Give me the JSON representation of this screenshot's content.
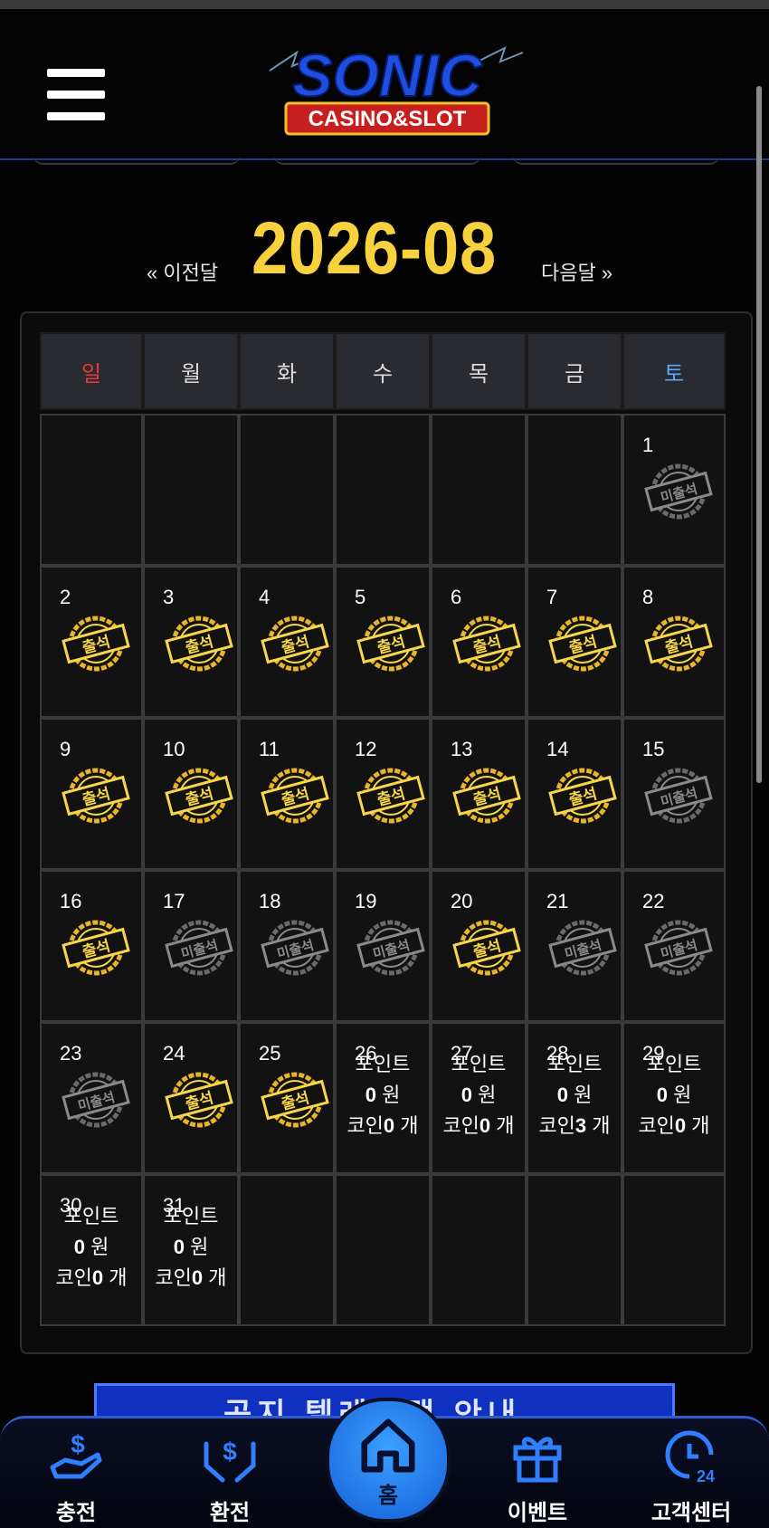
{
  "header": {
    "menu_icon": "hamburger-menu-icon",
    "logo": {
      "line1": "SONIC",
      "line2": "CASINO&SLOT"
    }
  },
  "calendar": {
    "month": "2026-08",
    "prev_label": "« 이전달",
    "next_label": "다음달 »",
    "weekdays": [
      "일",
      "월",
      "화",
      "수",
      "목",
      "금",
      "토"
    ],
    "weekday_colors": {
      "sun": "#e23a3a",
      "sat": "#5aa8ff",
      "default": "#dddddd"
    },
    "stamp_attended": "출석",
    "stamp_absent": "미출석",
    "reward_labels": {
      "points": "포인트",
      "won": "원",
      "coin": "코인",
      "count": "개"
    },
    "days": [
      {
        "day": "1",
        "status": "absent"
      },
      {
        "day": "2",
        "status": "attended"
      },
      {
        "day": "3",
        "status": "attended"
      },
      {
        "day": "4",
        "status": "attended"
      },
      {
        "day": "5",
        "status": "attended"
      },
      {
        "day": "6",
        "status": "attended"
      },
      {
        "day": "7",
        "status": "attended"
      },
      {
        "day": "8",
        "status": "attended"
      },
      {
        "day": "9",
        "status": "attended"
      },
      {
        "day": "10",
        "status": "attended"
      },
      {
        "day": "11",
        "status": "attended"
      },
      {
        "day": "12",
        "status": "attended"
      },
      {
        "day": "13",
        "status": "attended"
      },
      {
        "day": "14",
        "status": "attended"
      },
      {
        "day": "15",
        "status": "absent"
      },
      {
        "day": "16",
        "status": "attended"
      },
      {
        "day": "17",
        "status": "absent"
      },
      {
        "day": "18",
        "status": "absent"
      },
      {
        "day": "19",
        "status": "absent"
      },
      {
        "day": "20",
        "status": "attended"
      },
      {
        "day": "21",
        "status": "absent"
      },
      {
        "day": "22",
        "status": "absent"
      },
      {
        "day": "23",
        "status": "absent"
      },
      {
        "day": "24",
        "status": "attended"
      },
      {
        "day": "25",
        "status": "attended"
      },
      {
        "day": "26",
        "status": "future",
        "points": "0",
        "coins": "0"
      },
      {
        "day": "27",
        "status": "future",
        "points": "0",
        "coins": "0"
      },
      {
        "day": "28",
        "status": "future",
        "points": "0",
        "coins": "3"
      },
      {
        "day": "29",
        "status": "future",
        "points": "0",
        "coins": "0"
      },
      {
        "day": "30",
        "status": "future",
        "points": "0",
        "coins": "0"
      },
      {
        "day": "31",
        "status": "future",
        "points": "0",
        "coins": "0"
      }
    ],
    "first_weekday_index": 6
  },
  "banner": {
    "text": "공지 텔레그램 안내"
  },
  "bottom_nav": {
    "items": [
      {
        "label": "충전",
        "icon": "deposit-hand-icon"
      },
      {
        "label": "환전",
        "icon": "withdraw-hands-icon"
      },
      {
        "label": "홈",
        "icon": "home-icon"
      },
      {
        "label": "이벤트",
        "icon": "gift-icon"
      },
      {
        "label": "고객센터",
        "icon": "support-24-icon"
      }
    ]
  },
  "colors": {
    "accent_gold": "#f7d23e",
    "nav_blue": "#2c5bd6",
    "home_blue": "#3aa0ff"
  }
}
